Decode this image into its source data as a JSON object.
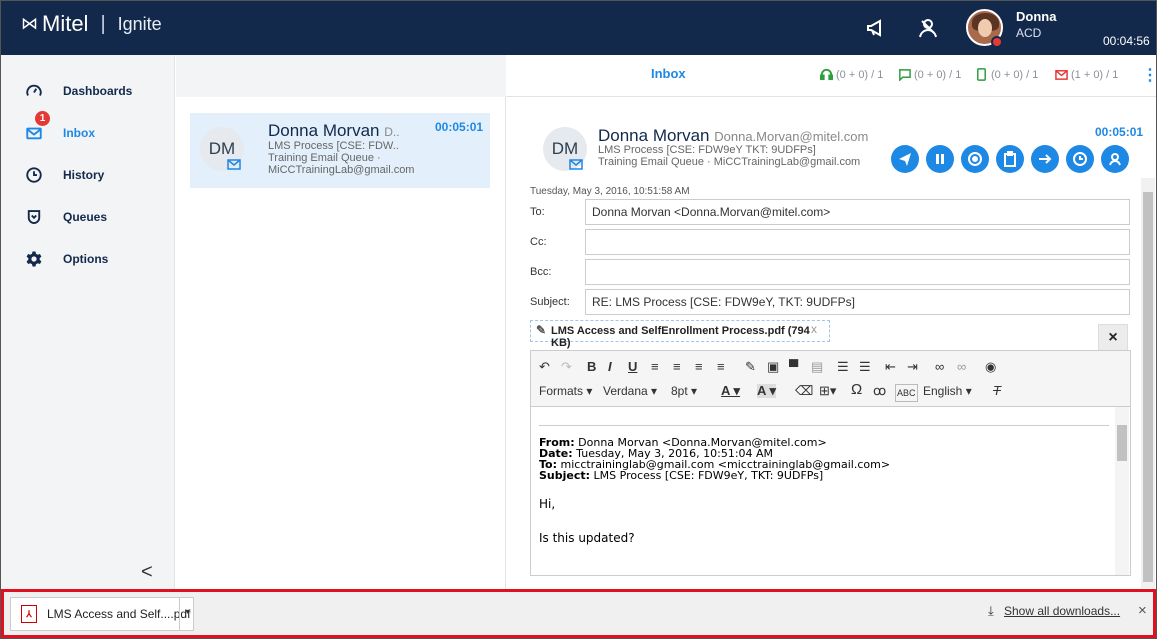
{
  "header": {
    "brand": "Mitel",
    "product": "Ignite",
    "user_name": "Donna",
    "user_state": "ACD",
    "timer": "00:04:56"
  },
  "sidebar": {
    "items": [
      {
        "label": "Dashboards"
      },
      {
        "label": "Inbox",
        "badge": "1"
      },
      {
        "label": "History"
      },
      {
        "label": "Queues"
      },
      {
        "label": "Options"
      }
    ],
    "collapse": "<"
  },
  "list": {
    "card": {
      "initials": "DM",
      "name": "Donna Morvan",
      "name_ellipsis": "D..",
      "time": "00:05:01",
      "line2": "LMS Process [CSE: FDW..",
      "line3": "Training Email Queue ·",
      "line4": "MiCCTrainingLab@gmail.com"
    }
  },
  "pane": {
    "title": "Inbox",
    "counters": [
      "(0 + 0) / 1",
      "(0 + 0) / 1",
      "(0 + 0) / 1",
      "(1 + 0) / 1"
    ]
  },
  "email": {
    "initials": "DM",
    "name": "Donna Morvan",
    "address": "Donna.Morvan@mitel.com",
    "subject_line": "LMS Process [CSE: FDW9eY TKT: 9UDFPs]",
    "queue_line": "Training Email Queue · MiCCTrainingLab@gmail.com",
    "time": "00:05:01",
    "date": "Tuesday, May 3, 2016, 10:51:58 AM",
    "fields": {
      "to_label": "To:",
      "to_value": "Donna Morvan <Donna.Morvan@mitel.com>",
      "cc_label": "Cc:",
      "cc_value": "",
      "bcc_label": "Bcc:",
      "bcc_value": "",
      "subject_label": "Subject:",
      "subject_value": "RE: LMS Process [CSE: FDW9eY, TKT: 9UDFPs]"
    },
    "attachment": "LMS Access and SelfEnrollment Process.pdf (794 KB)",
    "attachment_remove": "x",
    "close": "×"
  },
  "toolbar": {
    "formats": "Formats ▾",
    "font": "Verdana ▾",
    "size": "8pt ▾",
    "language": "English ▾",
    "omega": "Ω"
  },
  "body": {
    "from_label": "From:",
    "from_value": " Donna Morvan <Donna.Morvan@mitel.com>",
    "date_label": "Date:",
    "date_value": " Tuesday, May 3, 2016, 10:51:04 AM",
    "to_label": "To:",
    "to_value": " micctraininglab@gmail.com <micctraininglab@gmail.com>",
    "subject_label": "Subject:",
    "subject_value": " LMS Process [CSE: FDW9eY, TKT: 9UDFPs]",
    "greeting": "Hi,",
    "question": "Is this updated?"
  },
  "downloads": {
    "file": "LMS Access and Self....pdf",
    "show_all": "Show all downloads...",
    "close": "×"
  },
  "colors": {
    "header": "#13294b",
    "accent": "#1e88e5",
    "alert": "#e53935"
  }
}
